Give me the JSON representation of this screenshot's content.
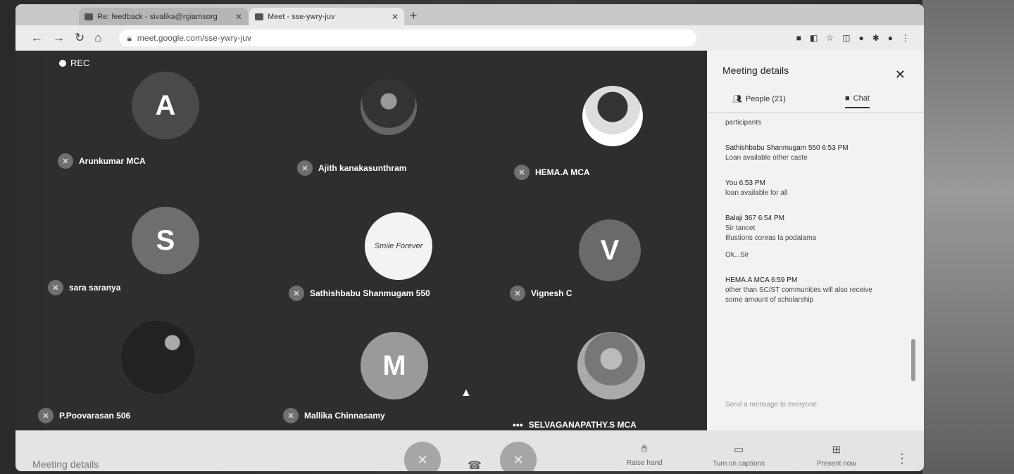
{
  "browser": {
    "tabs": [
      {
        "label": "Re: feedback - sivalika@rgiamsorg"
      },
      {
        "label": "Meet - sse-ywry-juv"
      }
    ],
    "new_tab_label": "+",
    "url": "meet.google.com/sse-ywry-juv"
  },
  "meeting": {
    "rec_label": "REC",
    "participants": [
      {
        "name": "Arunkumar MCA",
        "initial": "A",
        "avatar_type": "letter",
        "color": "#4a4a4a"
      },
      {
        "name": "Ajith kanakasunthram",
        "initial": "",
        "avatar_type": "photo",
        "color": "#333333"
      },
      {
        "name": "HEMA.A MCA",
        "initial": "",
        "avatar_type": "photo",
        "color": "#333333"
      },
      {
        "name": "sara saranya",
        "initial": "S",
        "avatar_type": "letter",
        "color": "#6e6e6e"
      },
      {
        "name": "Sathishbabu Shanmugam 550",
        "initial": "Smile Forever",
        "avatar_type": "white",
        "color": "#f3f3f3"
      },
      {
        "name": "Vignesh C",
        "initial": "V",
        "avatar_type": "letter",
        "color": "#6a6a6a"
      },
      {
        "name": "P.Poovarasan 506",
        "initial": "",
        "avatar_type": "photo",
        "color": "#222222"
      },
      {
        "name": "Mallika Chinnasamy",
        "initial": "M",
        "avatar_type": "letter",
        "color": "#9a9a9a"
      },
      {
        "name": "SELVAGANAPATHY.S MCA",
        "initial": "",
        "avatar_type": "photo",
        "color": "#555555"
      }
    ]
  },
  "panel": {
    "title": "Meeting details",
    "people_tab": "People (21)",
    "chat_tab": "Chat",
    "messages": [
      {
        "sender": "",
        "time": "",
        "lines": [
          "participants"
        ]
      },
      {
        "sender": "Sathishbabu Shanmugam 550",
        "time": "6:53 PM",
        "lines": [
          "Loan available other caste"
        ]
      },
      {
        "sender": "You",
        "time": "6:53 PM",
        "lines": [
          "loan available for all"
        ]
      },
      {
        "sender": "Balaji 367",
        "time": "6:54 PM",
        "lines": [
          "Sir tancet",
          "Illustions coreas la podalama",
          "Ok...Sir"
        ]
      },
      {
        "sender": "HEMA.A MCA",
        "time": "6:59 PM",
        "lines": [
          "other than SC/ST communities will also receive",
          "some amount of scholarship"
        ]
      }
    ],
    "compose_placeholder": "Send a message to everyone"
  },
  "bottom_bar": {
    "meeting_details": "Meeting details",
    "raise_hand": "Raise hand",
    "captions": "Turn on captions",
    "present": "Present now"
  },
  "colors": {
    "panel_bg": "#f2f2f2",
    "tile_bg": "#2e2e2e"
  }
}
